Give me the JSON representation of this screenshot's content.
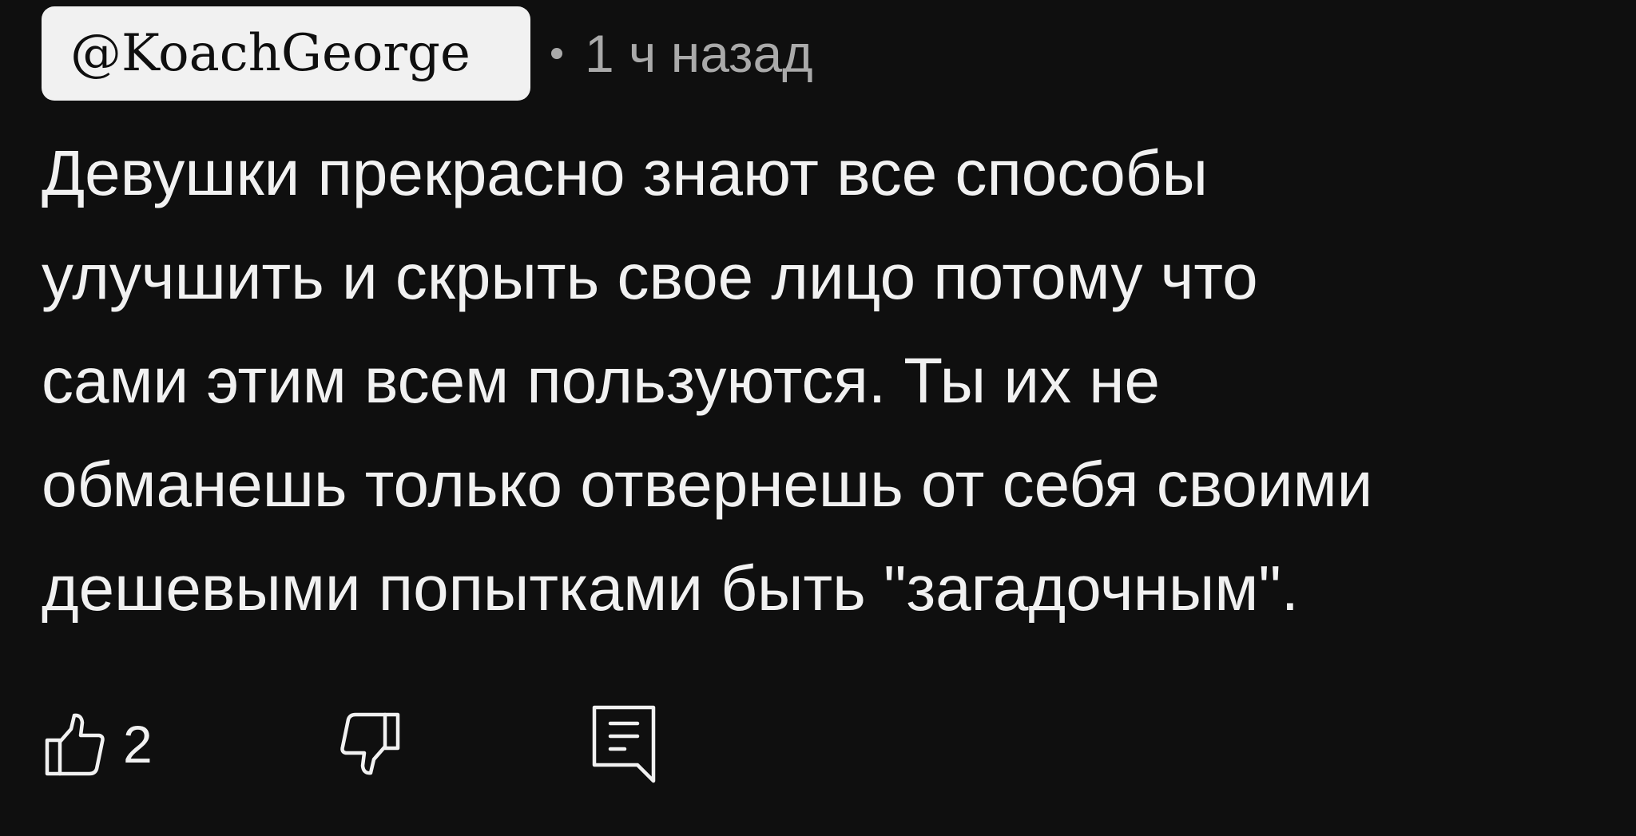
{
  "comment": {
    "author": "@KoachGeorge",
    "time": "1 ч назад",
    "text_lines": [
      "Девушки прекрасно знают все способы",
      "улучшить и скрыть свое лицо потому что",
      "сами этим всем пользуются.  Ты их не",
      "обманешь только отвернешь от себя своими",
      "дешевыми попытками быть \"загадочным\"."
    ],
    "like_count": "2"
  },
  "icons": {
    "like": "thumb-up-icon",
    "dislike": "thumb-down-icon",
    "reply": "reply-icon"
  },
  "colors": {
    "background": "#0f0f0f",
    "text": "#f1f1f1",
    "secondary_text": "#aaaaaa",
    "author_chip_bg": "#f1f1f1"
  }
}
